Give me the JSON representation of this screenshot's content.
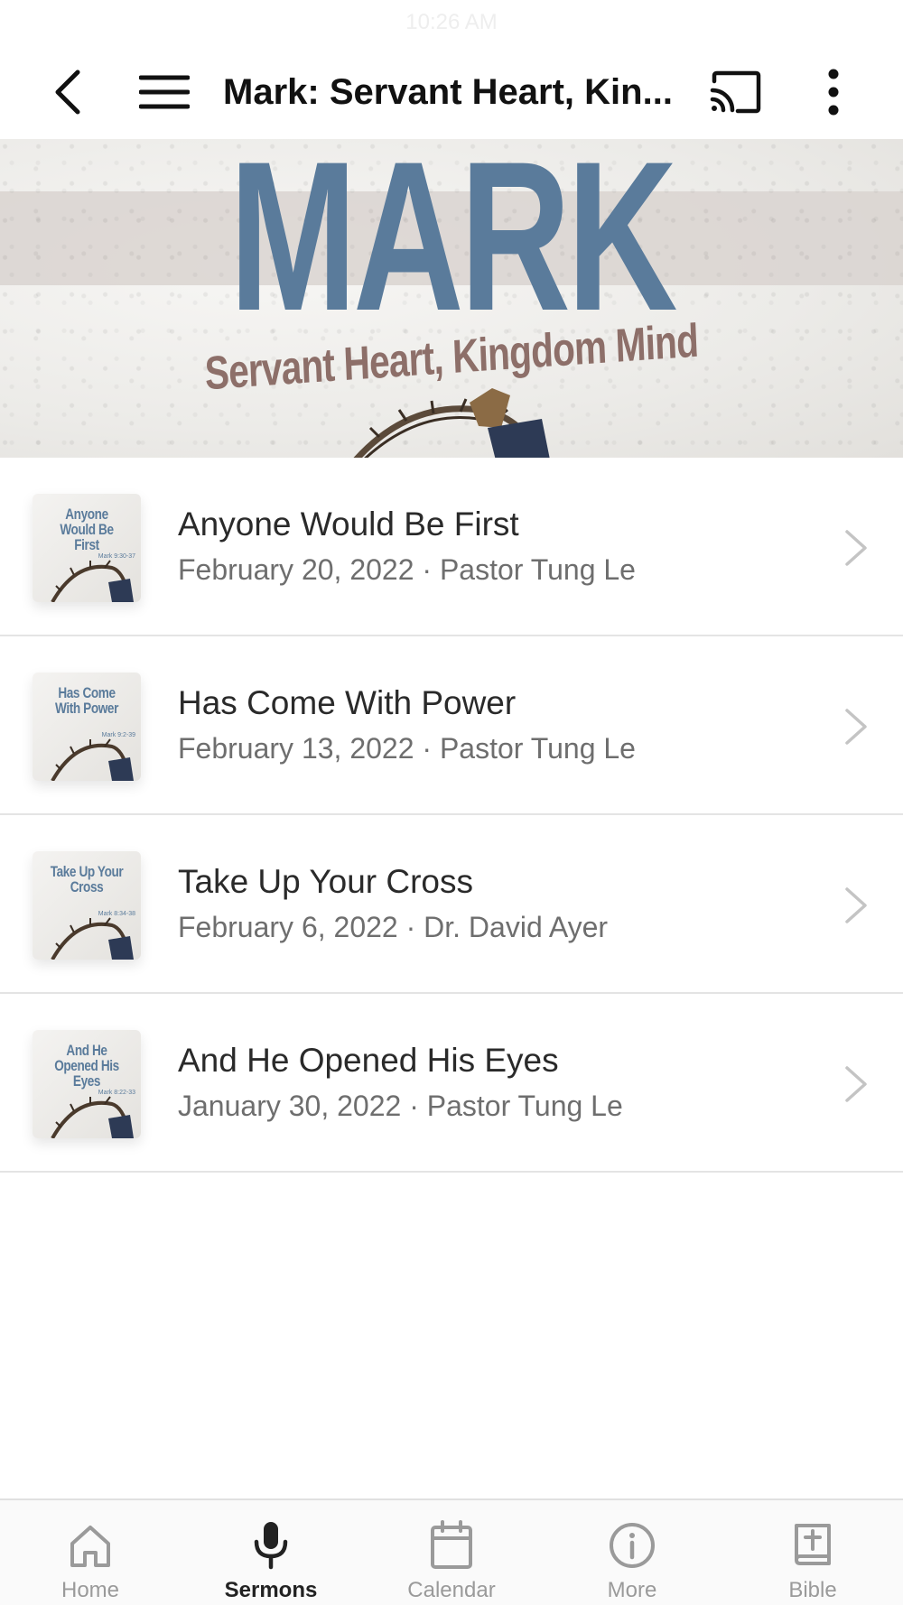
{
  "status_bar": {
    "time": "10:26 AM"
  },
  "header": {
    "title": "Mark: Servant Heart, Kin...",
    "back_icon": "chevron-left-icon",
    "menu_icon": "hamburger-menu-icon",
    "cast_icon": "cast-icon",
    "more_icon": "more-vertical-icon"
  },
  "banner": {
    "title": "MARK",
    "subtitle": "Servant Heart, Kingdom Mind",
    "colors": {
      "title": "#5a7b9b",
      "subtitle": "#8d6f69"
    }
  },
  "sermons": [
    {
      "title": "Anyone Would Be First",
      "meta": "February 20, 2022 · Pastor Tung Le",
      "thumb_title": "Anyone Would Be First",
      "thumb_ref": "Mark 9:30-37"
    },
    {
      "title": "Has Come With Power",
      "meta": "February 13, 2022 · Pastor Tung Le",
      "thumb_title": "Has Come With Power",
      "thumb_ref": "Mark 9:2-39"
    },
    {
      "title": "Take Up Your Cross",
      "meta": "February 6, 2022 · Dr. David Ayer",
      "thumb_title": "Take Up Your Cross",
      "thumb_ref": "Mark 8:34-38"
    },
    {
      "title": "And He Opened His Eyes",
      "meta": "January 30, 2022 · Pastor Tung Le",
      "thumb_title": "And He Opened His Eyes",
      "thumb_ref": "Mark 8:22-33"
    }
  ],
  "tabs": [
    {
      "label": "Home",
      "icon": "home-icon",
      "active": false
    },
    {
      "label": "Sermons",
      "icon": "microphone-icon",
      "active": true
    },
    {
      "label": "Calendar",
      "icon": "calendar-icon",
      "active": false
    },
    {
      "label": "More",
      "icon": "info-icon",
      "active": false
    },
    {
      "label": "Bible",
      "icon": "bible-icon",
      "active": false
    }
  ]
}
